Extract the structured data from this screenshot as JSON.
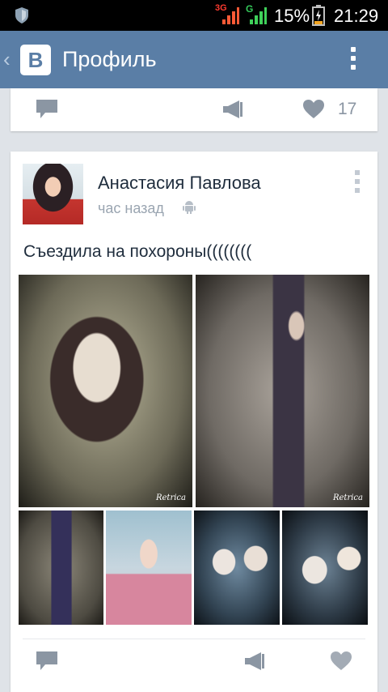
{
  "status_bar": {
    "network_3g": "3G",
    "network_g": "G",
    "battery_percent": "15%",
    "time": "21:29",
    "icons": [
      "shield-icon",
      "signal-icon",
      "battery-icon"
    ]
  },
  "app_bar": {
    "logo_letter": "В",
    "title": "Профиль",
    "icons": [
      "back-icon",
      "overflow-menu-icon"
    ]
  },
  "previous_post": {
    "likes_count": "17",
    "icons": [
      "comment-icon",
      "repost-icon",
      "like-icon"
    ]
  },
  "post": {
    "author": "Анастасия Павлова",
    "time": "час назад",
    "text": "Съездила на похороны((((((((",
    "photo_watermark": "Retrica",
    "photo_count": 6,
    "icons": [
      "android-icon",
      "post-menu-icon",
      "comment-icon",
      "repost-icon",
      "like-icon"
    ]
  },
  "colors": {
    "app_bar": "#5a7ea6",
    "background": "#dfe3e8",
    "action_icon": "#8b96a3",
    "like_icon": "#a3abb5"
  }
}
